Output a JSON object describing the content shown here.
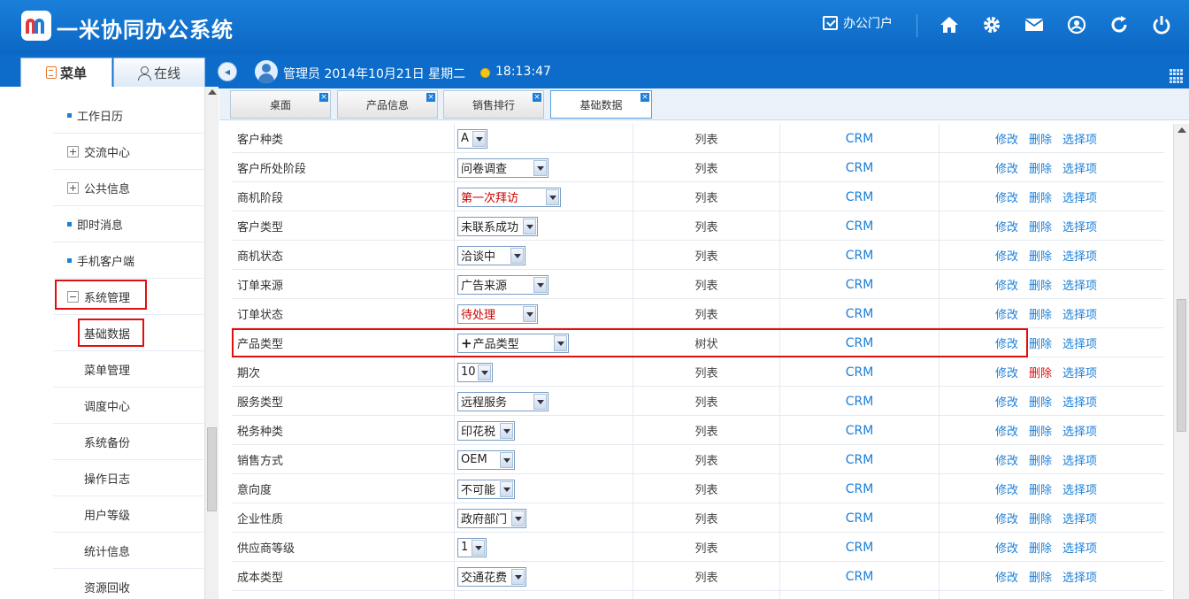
{
  "header": {
    "title": "一米协同办公系统",
    "portal_label": "办公门户",
    "icons": [
      "home-icon",
      "gear-icon",
      "mail-icon",
      "user-circle-icon",
      "refresh-icon",
      "power-icon"
    ]
  },
  "infobar": {
    "user_line": "管理员 2014年10月21日 星期二",
    "time": "18:13:47"
  },
  "sidebar": {
    "tabs": [
      {
        "label": "菜单",
        "active": true
      },
      {
        "label": "在线",
        "active": false
      }
    ],
    "items": [
      {
        "label": "工作日历",
        "kind": "leaf"
      },
      {
        "label": "交流中心",
        "kind": "collapsed"
      },
      {
        "label": "公共信息",
        "kind": "collapsed"
      },
      {
        "label": "即时消息",
        "kind": "leaf"
      },
      {
        "label": "手机客户端",
        "kind": "leaf"
      },
      {
        "label": "系统管理",
        "kind": "expanded",
        "highlighted": true
      },
      {
        "label": "基础数据",
        "kind": "sub",
        "highlighted": true
      },
      {
        "label": "菜单管理",
        "kind": "sub"
      },
      {
        "label": "调度中心",
        "kind": "sub"
      },
      {
        "label": "系统备份",
        "kind": "sub"
      },
      {
        "label": "操作日志",
        "kind": "sub"
      },
      {
        "label": "用户等级",
        "kind": "sub"
      },
      {
        "label": "统计信息",
        "kind": "sub"
      },
      {
        "label": "资源回收",
        "kind": "sub"
      }
    ]
  },
  "tabs": [
    {
      "label": "桌面",
      "active": false
    },
    {
      "label": "产品信息",
      "active": false
    },
    {
      "label": "销售排行",
      "active": false
    },
    {
      "label": "基础数据",
      "active": true
    }
  ],
  "actions": {
    "edit": "修改",
    "delete": "删除",
    "options": "选择项"
  },
  "rows": [
    {
      "name": "客户种类",
      "value": "A",
      "type": "列表",
      "module": "CRM"
    },
    {
      "name": "客户所处阶段",
      "value": "问卷调查",
      "type": "列表",
      "module": "CRM"
    },
    {
      "name": "商机阶段",
      "value": "第一次拜访",
      "type": "列表",
      "module": "CRM",
      "red": true
    },
    {
      "name": "客户类型",
      "value": "未联系成功",
      "type": "列表",
      "module": "CRM"
    },
    {
      "name": "商机状态",
      "value": "洽谈中",
      "type": "列表",
      "module": "CRM"
    },
    {
      "name": "订单来源",
      "value": "广告来源",
      "type": "列表",
      "module": "CRM"
    },
    {
      "name": "订单状态",
      "value": "待处理",
      "type": "列表",
      "module": "CRM",
      "red": true
    },
    {
      "name": "产品类型",
      "value": "产品类型",
      "type": "树状",
      "module": "CRM",
      "tree": true,
      "highlighted": true
    },
    {
      "name": "期次",
      "value": "10",
      "type": "列表",
      "module": "CRM",
      "delete_hover": true
    },
    {
      "name": "服务类型",
      "value": "远程服务",
      "type": "列表",
      "module": "CRM"
    },
    {
      "name": "税务种类",
      "value": "印花税",
      "type": "列表",
      "module": "CRM"
    },
    {
      "name": "销售方式",
      "value": "OEM",
      "type": "列表",
      "module": "CRM"
    },
    {
      "name": "意向度",
      "value": "不可能",
      "type": "列表",
      "module": "CRM"
    },
    {
      "name": "企业性质",
      "value": "政府部门",
      "type": "列表",
      "module": "CRM"
    },
    {
      "name": "供应商等级",
      "value": "1",
      "type": "列表",
      "module": "CRM"
    },
    {
      "name": "成本类型",
      "value": "交通花费",
      "type": "列表",
      "module": "CRM"
    }
  ]
}
